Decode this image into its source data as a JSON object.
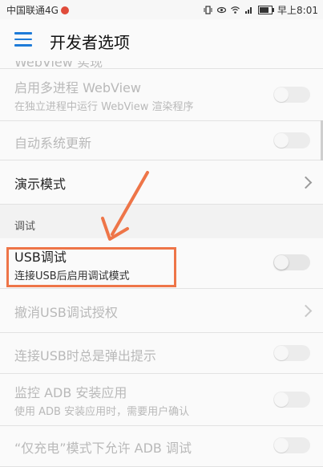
{
  "statusbar": {
    "carrier": "中国联通4G",
    "time": "早上8:01",
    "battery_level": 0.8
  },
  "appbar": {
    "title": "开发者选项",
    "menu_icon": "hamburger-menu-icon"
  },
  "rows": {
    "webview_impl": {
      "title": "WebView 实现"
    },
    "multiprocess_webview": {
      "title": "启用多进程 WebView",
      "subtitle": "在独立进程中运行 WebView 渲染程序",
      "enabled": false,
      "on": false
    },
    "auto_update": {
      "title": "自动系统更新",
      "enabled": false,
      "on": false
    },
    "demo_mode": {
      "title": "演示模式"
    },
    "section_debug": "调试",
    "usb_debug": {
      "title": "USB调试",
      "subtitle": "连接USB后启用调试模式",
      "on": false
    },
    "revoke_usb": {
      "title": "撤消USB调试授权"
    },
    "usb_prompt": {
      "title": "连接USB时总是弹出提示",
      "on": false
    },
    "adb_monitor": {
      "title": "监控 ADB 安装应用",
      "subtitle": "使用 ADB 安装应用时，需要用户确认",
      "on": false
    },
    "charge_only_adb": {
      "title": "“仅充电”模式下允许 ADB 调试",
      "on": false
    }
  },
  "colors": {
    "accent": "#1e7bd8",
    "annotation": "#ee7548"
  }
}
